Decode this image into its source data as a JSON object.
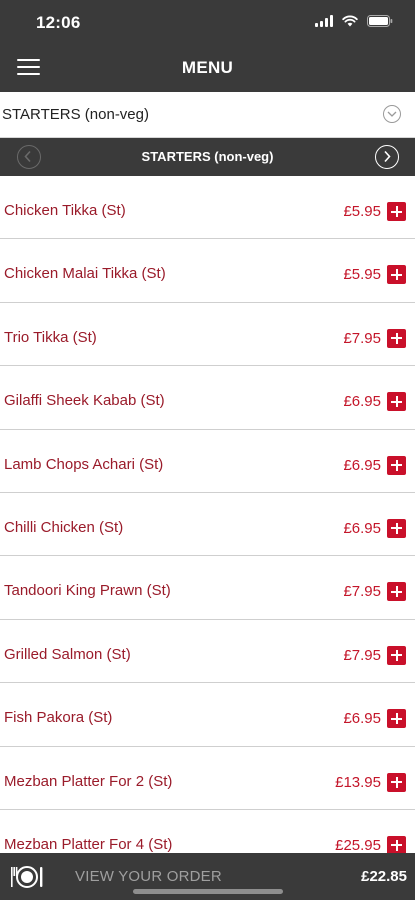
{
  "status_bar": {
    "time": "12:06"
  },
  "header": {
    "title": "MENU"
  },
  "category_select": {
    "value": "STARTERS (non-veg)"
  },
  "category_nav": {
    "title": "STARTERS (non-veg)"
  },
  "menu": {
    "items": [
      {
        "name": "Chicken Tikka (St)",
        "price": "£5.95"
      },
      {
        "name": "Chicken Malai Tikka (St)",
        "price": "£5.95"
      },
      {
        "name": "Trio Tikka (St)",
        "price": "£7.95"
      },
      {
        "name": "Gilaffi Sheek Kabab (St)",
        "price": "£6.95"
      },
      {
        "name": "Lamb Chops Achari (St)",
        "price": "£6.95"
      },
      {
        "name": "Chilli Chicken (St)",
        "price": "£6.95"
      },
      {
        "name": "Tandoori King Prawn (St)",
        "price": "£7.95"
      },
      {
        "name": "Grilled Salmon (St)",
        "price": "£7.95"
      },
      {
        "name": "Fish Pakora (St)",
        "price": "£6.95"
      },
      {
        "name": "Mezban Platter For 2 (St)",
        "price": "£13.95"
      },
      {
        "name": "Mezban Platter For 4 (St)",
        "price": "£25.95"
      }
    ]
  },
  "order_bar": {
    "label": "VIEW YOUR ORDER",
    "total": "£22.85"
  },
  "icons": {
    "menu": "hamburger-icon",
    "dropdown": "chevron-down-icon",
    "prev": "chevron-left-icon",
    "next": "chevron-right-icon",
    "add": "plus-icon",
    "order": "plate-cutlery-icon"
  },
  "colors": {
    "bar_background": "#3a3a3a",
    "item_name": "#9a1b2a",
    "price": "#c4162a",
    "add_button": "#c9102a"
  }
}
